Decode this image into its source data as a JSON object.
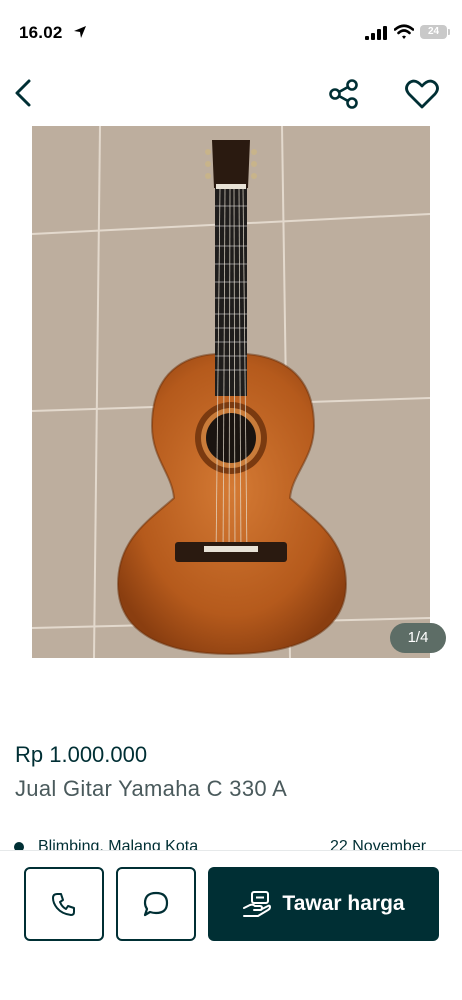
{
  "status_bar": {
    "time": "16.02",
    "battery": "24"
  },
  "nav": {
    "back_icon": "chevron-left-icon",
    "share_icon": "share-icon",
    "favorite_icon": "heart-icon"
  },
  "gallery": {
    "counter": "1/4",
    "current_index": 1,
    "total": 4,
    "image_subject": "classical guitar on tiled floor"
  },
  "listing": {
    "price": "Rp 1.000.000",
    "title": "Jual Gitar Yamaha C 330 A",
    "location": "Blimbing, Malang Kota",
    "date": "22 November"
  },
  "actions": {
    "call_icon": "phone-icon",
    "chat_icon": "chat-bubble-icon",
    "offer_label": "Tawar harga",
    "offer_icon": "hand-offer-icon"
  },
  "colors": {
    "primary": "#002f34",
    "text_muted": "#4a5a5c",
    "counter_bg": "#5d6d66"
  }
}
